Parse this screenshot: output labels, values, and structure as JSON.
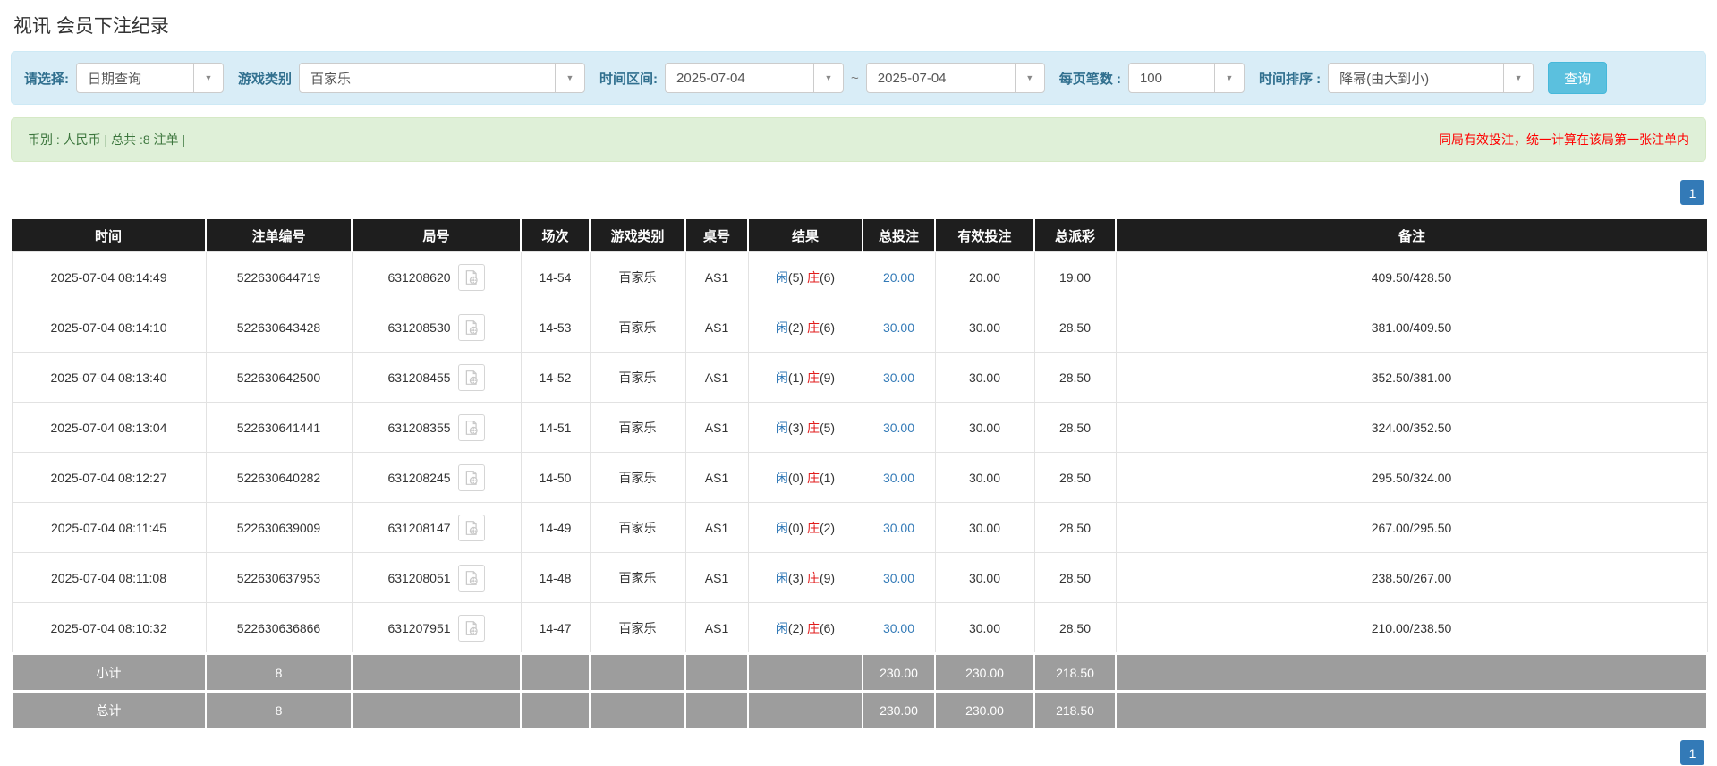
{
  "page": {
    "title": "视讯 会员下注纪录"
  },
  "filters": {
    "select_label": "请选择:",
    "select_value": "日期查询",
    "game_label": "游戏类别",
    "game_value": "百家乐",
    "range_label": "时间区间:",
    "date_from": "2025-07-04",
    "tilde": "~",
    "date_to": "2025-07-04",
    "per_page_label": "每页笔数 :",
    "per_page_value": "100",
    "sort_label": "时间排序 :",
    "sort_value": "降幂(由大到小)",
    "search_button": "查询"
  },
  "info_bar": {
    "summary": "币别 : 人民币 | 总共 :8 注单 |",
    "notice": "同局有效投注，统一计算在该局第一张注单内"
  },
  "pagination": {
    "page": "1"
  },
  "icons": {
    "caret": "caret-down-icon",
    "video": "video-icon"
  },
  "colors": {
    "filter_bg": "#d9edf7",
    "filter_label": "#31708f",
    "search_button": "#5bc0de",
    "info_bg": "#dff0d8",
    "info_text": "#3c763d",
    "notice_text": "#ff0000",
    "header_bg": "#1e1e1e",
    "footer_bg": "#9d9d9d",
    "link": "#337ab7",
    "player": "#337ab7",
    "banker": "#e01b1b",
    "page_active": "#337ab7"
  },
  "table": {
    "headers": [
      "时间",
      "注单编号",
      "局号",
      "场次",
      "游戏类别",
      "桌号",
      "结果",
      "总投注",
      "有效投注",
      "总派彩",
      "备注"
    ],
    "rows": [
      {
        "time": "2025-07-04 08:14:49",
        "bet_no": "522630644719",
        "round_no": "631208620",
        "session": "14-54",
        "game": "百家乐",
        "table_no": "AS1",
        "player": "闲",
        "player_num": "(5)",
        "banker": "庄",
        "banker_num": "(6)",
        "total_bet": "20.00",
        "valid_bet": "20.00",
        "payout": "19.00",
        "remark": "409.50/428.50"
      },
      {
        "time": "2025-07-04 08:14:10",
        "bet_no": "522630643428",
        "round_no": "631208530",
        "session": "14-53",
        "game": "百家乐",
        "table_no": "AS1",
        "player": "闲",
        "player_num": "(2)",
        "banker": "庄",
        "banker_num": "(6)",
        "total_bet": "30.00",
        "valid_bet": "30.00",
        "payout": "28.50",
        "remark": "381.00/409.50"
      },
      {
        "time": "2025-07-04 08:13:40",
        "bet_no": "522630642500",
        "round_no": "631208455",
        "session": "14-52",
        "game": "百家乐",
        "table_no": "AS1",
        "player": "闲",
        "player_num": "(1)",
        "banker": "庄",
        "banker_num": "(9)",
        "total_bet": "30.00",
        "valid_bet": "30.00",
        "payout": "28.50",
        "remark": "352.50/381.00"
      },
      {
        "time": "2025-07-04 08:13:04",
        "bet_no": "522630641441",
        "round_no": "631208355",
        "session": "14-51",
        "game": "百家乐",
        "table_no": "AS1",
        "player": "闲",
        "player_num": "(3)",
        "banker": "庄",
        "banker_num": "(5)",
        "total_bet": "30.00",
        "valid_bet": "30.00",
        "payout": "28.50",
        "remark": "324.00/352.50"
      },
      {
        "time": "2025-07-04 08:12:27",
        "bet_no": "522630640282",
        "round_no": "631208245",
        "session": "14-50",
        "game": "百家乐",
        "table_no": "AS1",
        "player": "闲",
        "player_num": "(0)",
        "banker": "庄",
        "banker_num": "(1)",
        "total_bet": "30.00",
        "valid_bet": "30.00",
        "payout": "28.50",
        "remark": "295.50/324.00"
      },
      {
        "time": "2025-07-04 08:11:45",
        "bet_no": "522630639009",
        "round_no": "631208147",
        "session": "14-49",
        "game": "百家乐",
        "table_no": "AS1",
        "player": "闲",
        "player_num": "(0)",
        "banker": "庄",
        "banker_num": "(2)",
        "total_bet": "30.00",
        "valid_bet": "30.00",
        "payout": "28.50",
        "remark": "267.00/295.50"
      },
      {
        "time": "2025-07-04 08:11:08",
        "bet_no": "522630637953",
        "round_no": "631208051",
        "session": "14-48",
        "game": "百家乐",
        "table_no": "AS1",
        "player": "闲",
        "player_num": "(3)",
        "banker": "庄",
        "banker_num": "(9)",
        "total_bet": "30.00",
        "valid_bet": "30.00",
        "payout": "28.50",
        "remark": "238.50/267.00"
      },
      {
        "time": "2025-07-04 08:10:32",
        "bet_no": "522630636866",
        "round_no": "631207951",
        "session": "14-47",
        "game": "百家乐",
        "table_no": "AS1",
        "player": "闲",
        "player_num": "(2)",
        "banker": "庄",
        "banker_num": "(6)",
        "total_bet": "30.00",
        "valid_bet": "30.00",
        "payout": "28.50",
        "remark": "210.00/238.50"
      }
    ],
    "subtotal": {
      "label": "小计",
      "count": "8",
      "total_bet": "230.00",
      "valid_bet": "230.00",
      "payout": "218.50"
    },
    "total": {
      "label": "总计",
      "count": "8",
      "total_bet": "230.00",
      "valid_bet": "230.00",
      "payout": "218.50"
    }
  }
}
